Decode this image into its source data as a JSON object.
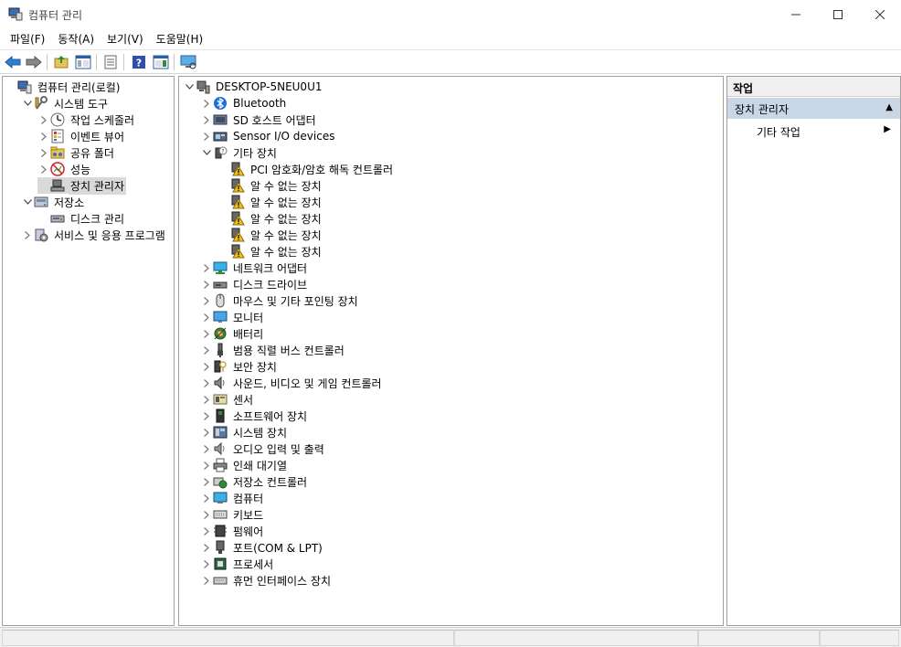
{
  "window": {
    "title": "컴퓨터 관리"
  },
  "menu": [
    {
      "label": "파일(F)"
    },
    {
      "label": "동작(A)"
    },
    {
      "label": "보기(V)"
    },
    {
      "label": "도움말(H)"
    }
  ],
  "left_tree": [
    {
      "label": "컴퓨터 관리(로컬)",
      "icon": "computer-management-icon",
      "arrow": "",
      "indent": 0
    },
    {
      "label": "시스템 도구",
      "icon": "system-tools-icon",
      "arrow": "down",
      "indent": 1
    },
    {
      "label": "작업 스케줄러",
      "icon": "clock-icon",
      "arrow": "right",
      "indent": 2
    },
    {
      "label": "이벤트 뷰어",
      "icon": "event-viewer-icon",
      "arrow": "right",
      "indent": 2
    },
    {
      "label": "공유 폴더",
      "icon": "shared-folder-icon",
      "arrow": "right",
      "indent": 2
    },
    {
      "label": "성능",
      "icon": "performance-icon",
      "arrow": "right",
      "indent": 2
    },
    {
      "label": "장치 관리자",
      "icon": "device-manager-icon",
      "arrow": "",
      "indent": 2,
      "selected": true
    },
    {
      "label": "저장소",
      "icon": "storage-icon",
      "arrow": "down",
      "indent": 1
    },
    {
      "label": "디스크 관리",
      "icon": "disk-management-icon",
      "arrow": "",
      "indent": 2
    },
    {
      "label": "서비스 및 응용 프로그램",
      "icon": "services-icon",
      "arrow": "right",
      "indent": 1
    }
  ],
  "device_tree": {
    "root": "DESKTOP-5NEU0U1",
    "items": [
      {
        "label": "Bluetooth",
        "icon": "bluetooth-icon",
        "arrow": "right",
        "indent": 1
      },
      {
        "label": "SD 호스트 어댑터",
        "icon": "sd-host-icon",
        "arrow": "right",
        "indent": 1
      },
      {
        "label": "Sensor I/O devices",
        "icon": "sensor-io-icon",
        "arrow": "right",
        "indent": 1
      },
      {
        "label": "기타 장치",
        "icon": "other-devices-icon",
        "arrow": "down",
        "indent": 1
      },
      {
        "label": "PCI 암호화/암호 해독 컨트롤러",
        "icon": "warning-device-icon",
        "arrow": "",
        "indent": 2
      },
      {
        "label": "알 수 없는 장치",
        "icon": "warning-device-icon",
        "arrow": "",
        "indent": 2
      },
      {
        "label": "알 수 없는 장치",
        "icon": "warning-device-icon",
        "arrow": "",
        "indent": 2
      },
      {
        "label": "알 수 없는 장치",
        "icon": "warning-device-icon",
        "arrow": "",
        "indent": 2
      },
      {
        "label": "알 수 없는 장치",
        "icon": "warning-device-icon",
        "arrow": "",
        "indent": 2
      },
      {
        "label": "알 수 없는 장치",
        "icon": "warning-device-icon",
        "arrow": "",
        "indent": 2
      },
      {
        "label": "네트워크 어댑터",
        "icon": "network-adapter-icon",
        "arrow": "right",
        "indent": 1
      },
      {
        "label": "디스크 드라이브",
        "icon": "disk-drive-icon",
        "arrow": "right",
        "indent": 1
      },
      {
        "label": "마우스 및 기타 포인팅 장치",
        "icon": "mouse-icon",
        "arrow": "right",
        "indent": 1
      },
      {
        "label": "모니터",
        "icon": "monitor-icon",
        "arrow": "right",
        "indent": 1
      },
      {
        "label": "배터리",
        "icon": "battery-icon",
        "arrow": "right",
        "indent": 1
      },
      {
        "label": "범용 직렬 버스 컨트롤러",
        "icon": "usb-icon",
        "arrow": "right",
        "indent": 1
      },
      {
        "label": "보안 장치",
        "icon": "security-device-icon",
        "arrow": "right",
        "indent": 1
      },
      {
        "label": "사운드, 비디오 및 게임 컨트롤러",
        "icon": "speaker-icon",
        "arrow": "right",
        "indent": 1
      },
      {
        "label": "센서",
        "icon": "sensor-icon",
        "arrow": "right",
        "indent": 1
      },
      {
        "label": "소프트웨어 장치",
        "icon": "software-device-icon",
        "arrow": "right",
        "indent": 1
      },
      {
        "label": "시스템 장치",
        "icon": "system-device-icon",
        "arrow": "right",
        "indent": 1
      },
      {
        "label": "오디오 입력 및 출력",
        "icon": "audio-icon",
        "arrow": "right",
        "indent": 1
      },
      {
        "label": "인쇄 대기열",
        "icon": "printer-icon",
        "arrow": "right",
        "indent": 1
      },
      {
        "label": "저장소 컨트롤러",
        "icon": "storage-controller-icon",
        "arrow": "right",
        "indent": 1
      },
      {
        "label": "컴퓨터",
        "icon": "computer-icon",
        "arrow": "right",
        "indent": 1
      },
      {
        "label": "키보드",
        "icon": "keyboard-icon",
        "arrow": "right",
        "indent": 1
      },
      {
        "label": "펌웨어",
        "icon": "firmware-icon",
        "arrow": "right",
        "indent": 1
      },
      {
        "label": "포트(COM & LPT)",
        "icon": "port-icon",
        "arrow": "right",
        "indent": 1
      },
      {
        "label": "프로세서",
        "icon": "processor-icon",
        "arrow": "right",
        "indent": 1
      },
      {
        "label": "휴먼 인터페이스 장치",
        "icon": "hid-icon",
        "arrow": "right",
        "indent": 1
      }
    ]
  },
  "actions": {
    "header": "작업",
    "section": "장치 관리자",
    "item": "기타 작업"
  },
  "colors": {
    "selection": "#d9d9d9",
    "actions_section_bg": "#c8d6e6",
    "warning": "#f0c020"
  }
}
